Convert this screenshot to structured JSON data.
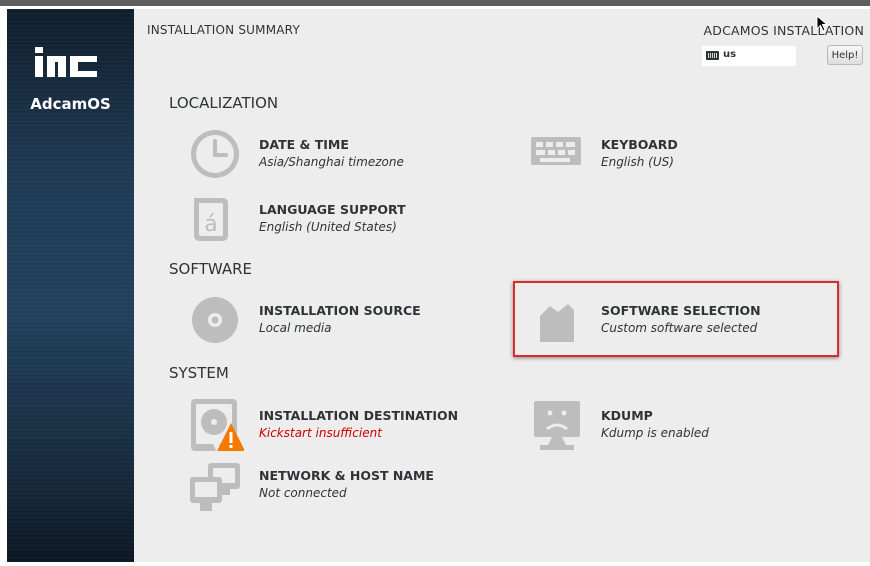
{
  "sidebar": {
    "logo_text": "inc",
    "brand": "AdcamOS"
  },
  "header": {
    "title": "INSTALLATION SUMMARY",
    "product": "ADCAMOS INSTALLATION",
    "keyboard_layout": "us",
    "help_label": "Help!"
  },
  "sections": {
    "localization": "LOCALIZATION",
    "software": "SOFTWARE",
    "system": "SYSTEM"
  },
  "spokes": {
    "date_time": {
      "name": "DATE & TIME",
      "status": "Asia/Shanghai timezone",
      "icon": "clock-icon"
    },
    "keyboard": {
      "name": "KEYBOARD",
      "status": "English (US)",
      "icon": "keyboard-icon"
    },
    "language": {
      "name": "LANGUAGE SUPPORT",
      "status": "English (United States)",
      "icon": "language-icon"
    },
    "source": {
      "name": "INSTALLATION SOURCE",
      "status": "Local media",
      "icon": "disc-icon"
    },
    "software": {
      "name": "SOFTWARE SELECTION",
      "status": "Custom software selected",
      "icon": "package-icon"
    },
    "destination": {
      "name": "INSTALLATION DESTINATION",
      "status": "Kickstart insufficient",
      "icon": "harddisk-warning-icon"
    },
    "kdump": {
      "name": "KDUMP",
      "status": "Kdump is enabled",
      "icon": "kdump-icon"
    },
    "network": {
      "name": "NETWORK & HOST NAME",
      "status": "Not connected",
      "icon": "network-icon"
    }
  },
  "colors": {
    "warning_text": "#cc0000",
    "highlight_border": "#d92c2c",
    "warning_triangle": "#f57900",
    "icon_gray": "#bdbdbd"
  }
}
